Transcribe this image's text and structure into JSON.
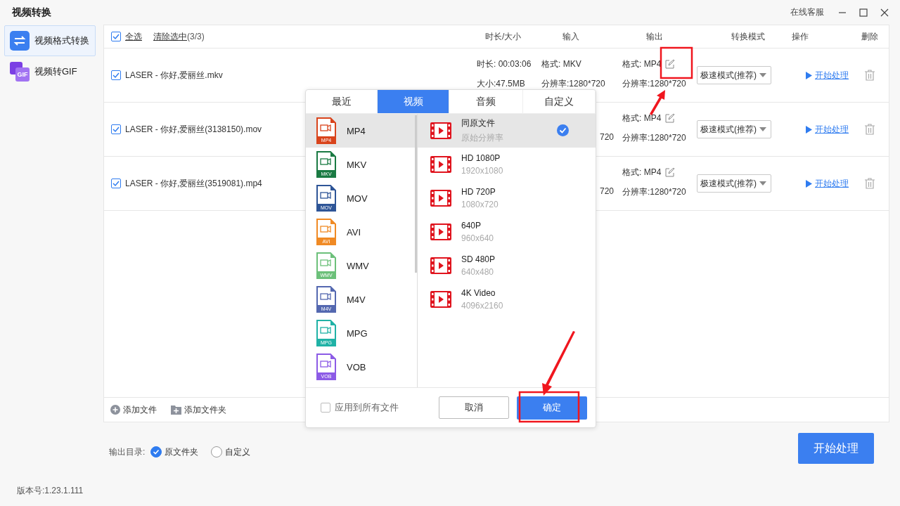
{
  "window": {
    "title": "视频转换",
    "support_link": "在线客服"
  },
  "sidebar": {
    "items": [
      {
        "label": "视频格式转换",
        "selected": true,
        "kind": "convert"
      },
      {
        "label": "视频转GIF",
        "selected": false,
        "kind": "gif",
        "icon_text": "GIF"
      }
    ]
  },
  "table": {
    "select_all": {
      "label": "全选",
      "checked": true
    },
    "clear_selection": {
      "label": "清除选中",
      "count": "(3/3)"
    },
    "columns": [
      "时长/大小",
      "输入",
      "输出",
      "转换模式",
      "操作",
      "删除"
    ],
    "rows": [
      {
        "checked": true,
        "filename": "LASER - 你好,爱丽丝.mkv",
        "duration": "时长: 00:03:06",
        "size": "大小:47.5MB",
        "input_format": "格式: MKV",
        "input_resolution": "分辨率:1280*720",
        "output_format": "格式: MP4",
        "output_resolution": "分辨率:1280*720",
        "mode": "极速模式(推荐)",
        "action": "开始处理"
      },
      {
        "checked": true,
        "filename": "LASER - 你好,爱丽丝(3138150).mov",
        "input_resolution_visible_part": "720",
        "output_format": "格式: MP4",
        "output_resolution": "分辨率:1280*720",
        "mode": "极速模式(推荐)",
        "action": "开始处理"
      },
      {
        "checked": true,
        "filename": "LASER - 你好,爱丽丝(3519081).mp4",
        "input_resolution_visible_part": "720",
        "output_format": "格式: MP4",
        "output_resolution": "分辨率:1280*720",
        "mode": "极速模式(推荐)",
        "action": "开始处理"
      }
    ],
    "add_buttons": [
      {
        "label": "添加文件",
        "kind": "file"
      },
      {
        "label": "添加文件夹",
        "kind": "folder"
      }
    ]
  },
  "format_dialog": {
    "tabs": [
      {
        "label": "最近",
        "selected": false
      },
      {
        "label": "视频",
        "selected": true
      },
      {
        "label": "音频",
        "selected": false
      },
      {
        "label": "自定义",
        "selected": false
      }
    ],
    "formats": [
      {
        "label": "MP4",
        "badge": "MP4",
        "color": "#d9441c",
        "selected": true
      },
      {
        "label": "MKV",
        "badge": "MKV",
        "color": "#1a7a43",
        "selected": false
      },
      {
        "label": "MOV",
        "badge": "MOV",
        "color": "#2e5597",
        "selected": false
      },
      {
        "label": "AVI",
        "badge": "AVI",
        "color": "#f08a24",
        "selected": false
      },
      {
        "label": "WMV",
        "badge": "WMV",
        "color": "#6cc07a",
        "selected": false
      },
      {
        "label": "M4V",
        "badge": "M4V",
        "color": "#5468b0",
        "selected": false
      },
      {
        "label": "MPG",
        "badge": "MPG",
        "color": "#20b2a6",
        "selected": false
      },
      {
        "label": "VOB",
        "badge": "VOB",
        "color": "#8c5be6",
        "selected": false
      }
    ],
    "presets": [
      {
        "name": "同原文件",
        "resolution": "原始分辨率",
        "selected": true
      },
      {
        "name": "HD 1080P",
        "resolution": "1920x1080",
        "selected": false
      },
      {
        "name": "HD 720P",
        "resolution": "1080x720",
        "selected": false
      },
      {
        "name": "640P",
        "resolution": "960x640",
        "selected": false
      },
      {
        "name": "SD 480P",
        "resolution": "640x480",
        "selected": false
      },
      {
        "name": "4K Video",
        "resolution": "4096x2160",
        "selected": false
      }
    ],
    "apply_all": {
      "label": "应用到所有文件",
      "checked": false
    },
    "cancel_button": "取消",
    "confirm_button": "确定"
  },
  "output_dir": {
    "label": "输出目录:",
    "options": [
      {
        "label": "原文件夹",
        "selected": true
      },
      {
        "label": "自定义",
        "selected": false
      }
    ]
  },
  "start_button": "开始处理",
  "version": "版本号:1.23.1.111"
}
